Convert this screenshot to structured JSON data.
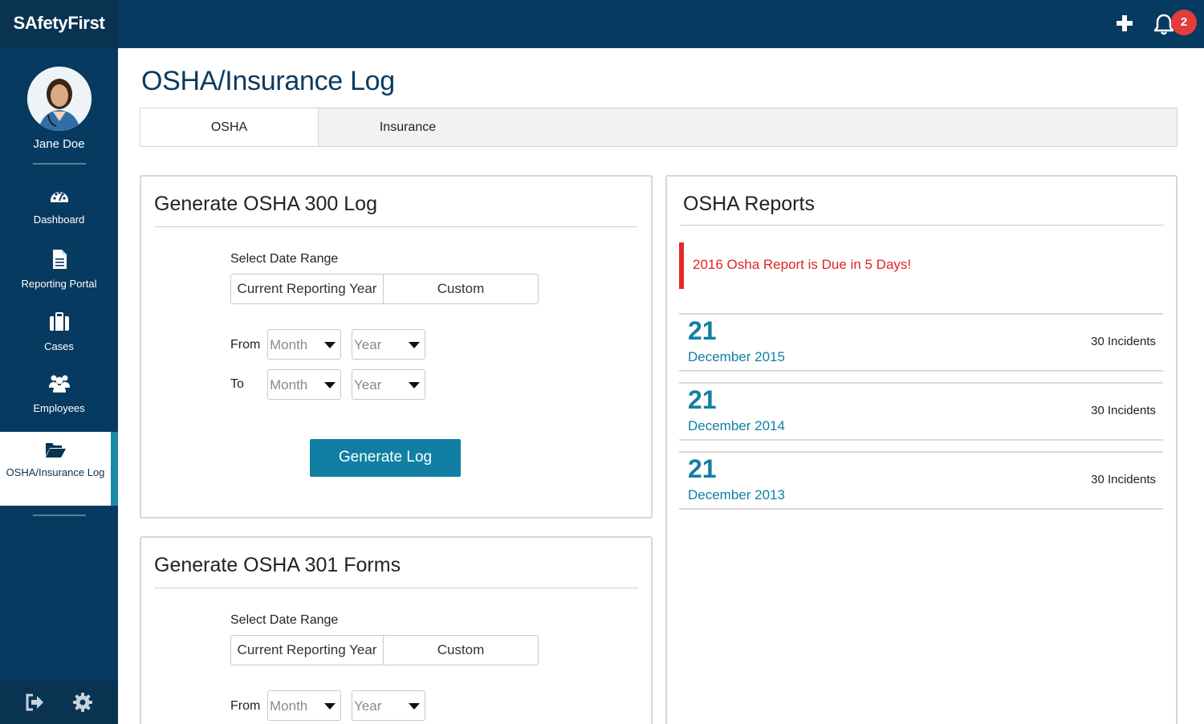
{
  "app": {
    "brand": "SAfetyFirst"
  },
  "topbar": {
    "notification_count": "2",
    "icons": [
      "plus-icon",
      "bell-icon"
    ]
  },
  "user": {
    "name": "Jane Doe"
  },
  "sidebar": {
    "items": [
      {
        "label": "Dashboard",
        "icon": "dashboard-gauge-icon"
      },
      {
        "label": "Reporting Portal",
        "icon": "document-icon"
      },
      {
        "label": "Cases",
        "icon": "briefcase-icon"
      },
      {
        "label": "Employees",
        "icon": "users-icon"
      },
      {
        "label": "OSHA/Insurance Log",
        "icon": "folder-open-icon",
        "active": true
      }
    ],
    "footer_icons": [
      "logout-icon",
      "settings-gear-icon"
    ]
  },
  "page": {
    "title": "OSHA/Insurance Log"
  },
  "tabs": [
    {
      "label": "OSHA",
      "active": true
    },
    {
      "label": "Insurance",
      "active": false
    }
  ],
  "osha300": {
    "title": "Generate OSHA 300 Log",
    "range_label": "Select Date Range",
    "range_options": [
      "Current Reporting Year",
      "Custom"
    ],
    "from_label": "From",
    "to_label": "To",
    "month_placeholder": "Month",
    "year_placeholder": "Year",
    "generate_label": "Generate Log"
  },
  "osha301": {
    "title": "Generate OSHA 301 Forms",
    "range_label": "Select Date Range",
    "range_options": [
      "Current Reporting Year",
      "Custom"
    ],
    "from_label": "From",
    "month_placeholder": "Month",
    "year_placeholder": "Year"
  },
  "reports": {
    "title": "OSHA Reports",
    "alert": "2016 Osha Report is Due in 5 Days!",
    "rows": [
      {
        "day": "21",
        "date": "December 2015",
        "count": "30 Incidents"
      },
      {
        "day": "21",
        "date": "December 2014",
        "count": "30 Incidents"
      },
      {
        "day": "21",
        "date": "December 2013",
        "count": "30 Incidents"
      }
    ]
  },
  "colors": {
    "navy": "#073a60",
    "accent": "#117fa3",
    "alert": "#e22b2b",
    "badge": "#e63c3c"
  }
}
